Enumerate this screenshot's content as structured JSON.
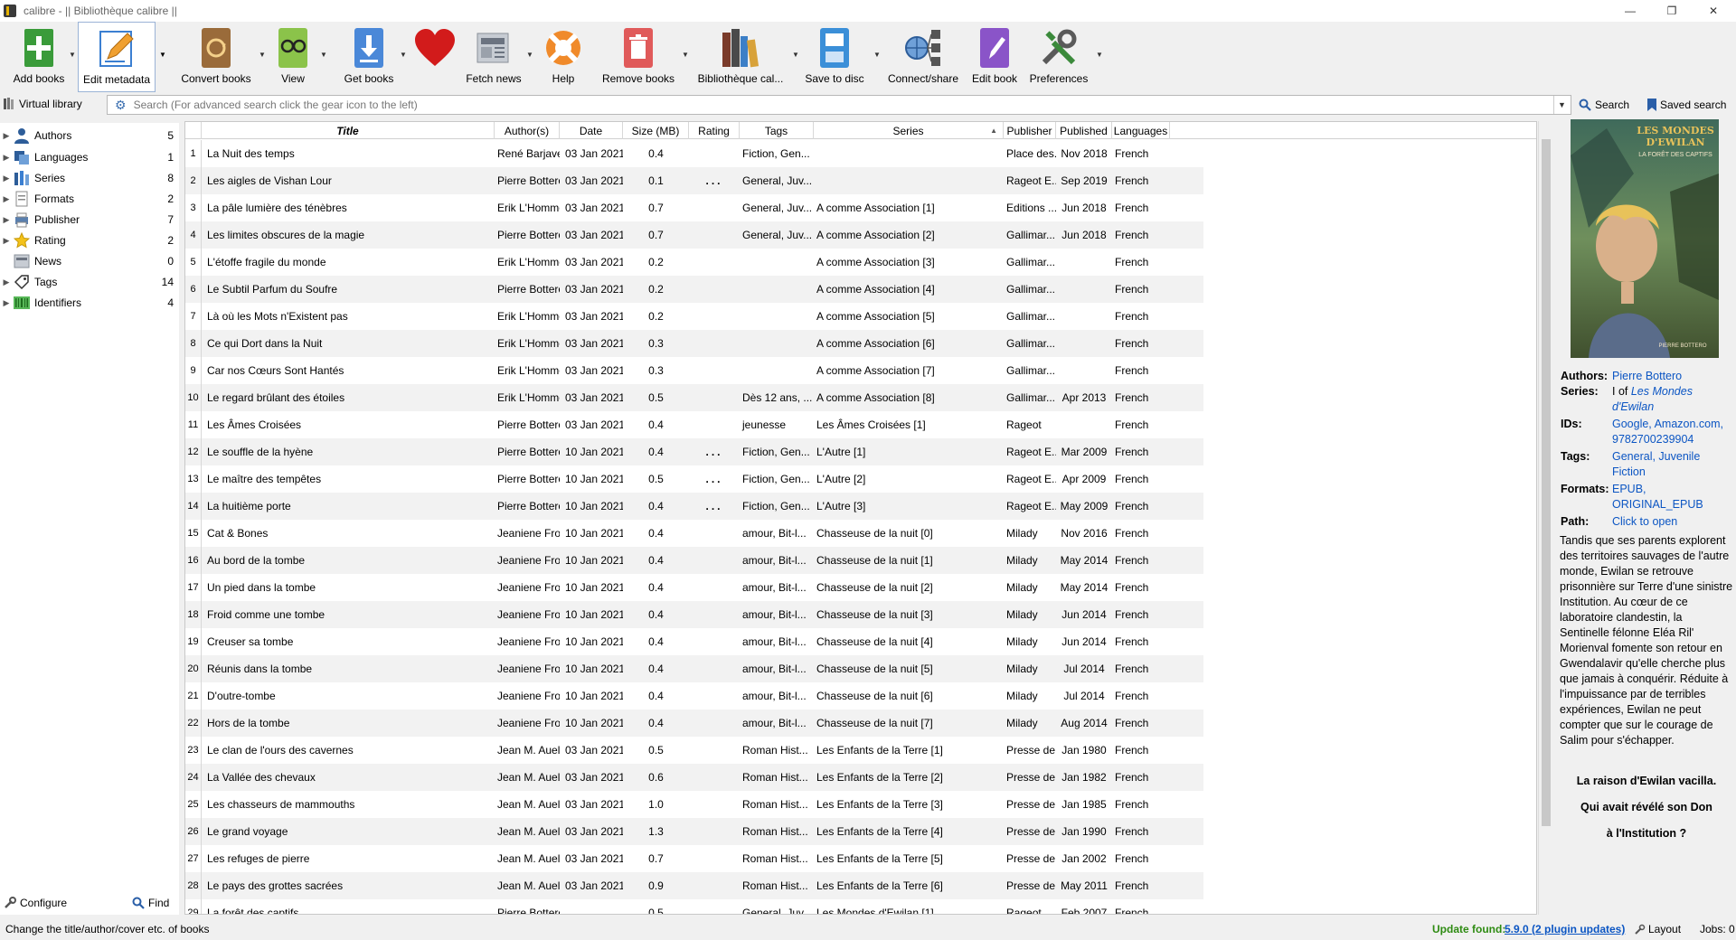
{
  "window": {
    "title": "calibre - || Bibliothèque calibre ||",
    "controls": [
      "—",
      "❐",
      "✕"
    ]
  },
  "toolbar": {
    "buttons": [
      {
        "label": "Add books",
        "icon": "add-books-icon",
        "has_menu": true
      },
      {
        "label": "Edit metadata",
        "icon": "edit-metadata-icon",
        "has_menu": true,
        "active": true
      },
      {
        "label": "Convert books",
        "icon": "convert-books-icon",
        "has_menu": true
      },
      {
        "label": "View",
        "icon": "view-icon",
        "has_menu": true
      },
      {
        "label": "Get books",
        "icon": "get-books-icon",
        "has_menu": true
      },
      {
        "label": "",
        "icon": "heart-icon",
        "has_menu": false
      },
      {
        "label": "Fetch news",
        "icon": "fetch-news-icon",
        "has_menu": true
      },
      {
        "label": "Help",
        "icon": "help-icon",
        "has_menu": false
      },
      {
        "label": "Remove books",
        "icon": "remove-books-icon",
        "has_menu": true
      },
      {
        "label": "Bibliothèque cal...",
        "icon": "library-icon",
        "has_menu": true
      },
      {
        "label": "Save to disc",
        "icon": "save-to-disc-icon",
        "has_menu": true
      },
      {
        "label": "Connect/share",
        "icon": "connect-share-icon",
        "has_menu": true
      },
      {
        "label": "Edit book",
        "icon": "edit-book-icon",
        "has_menu": false
      },
      {
        "label": "Preferences",
        "icon": "preferences-icon",
        "has_menu": true
      }
    ]
  },
  "search": {
    "virtual_library": "Virtual library",
    "placeholder": "Search (For advanced search click the gear icon to the left)",
    "search_label": "Search",
    "saved_search_label": "Saved search"
  },
  "tag_browser": {
    "items": [
      {
        "label": "Authors",
        "count": "5",
        "icon": "authors-icon"
      },
      {
        "label": "Languages",
        "count": "1",
        "icon": "languages-icon"
      },
      {
        "label": "Series",
        "count": "8",
        "icon": "series-icon"
      },
      {
        "label": "Formats",
        "count": "2",
        "icon": "formats-icon"
      },
      {
        "label": "Publisher",
        "count": "7",
        "icon": "publisher-icon"
      },
      {
        "label": "Rating",
        "count": "2",
        "icon": "rating-icon"
      },
      {
        "label": "News",
        "count": "0",
        "icon": "news-icon"
      },
      {
        "label": "Tags",
        "count": "14",
        "icon": "tags-icon"
      },
      {
        "label": "Identifiers",
        "count": "4",
        "icon": "identifiers-icon"
      }
    ],
    "configure_label": "Configure",
    "find_label": "Find"
  },
  "table": {
    "columns": [
      "Title",
      "Author(s)",
      "Date",
      "Size (MB)",
      "Rating",
      "Tags",
      "Series",
      "Publisher",
      "Published",
      "Languages"
    ],
    "rows": [
      [
        "La Nuit des temps",
        "René Barjavel",
        "03 Jan 2021",
        "0.4",
        "",
        "Fiction, Gen...",
        "",
        "Place des...",
        "Nov 2018",
        "French"
      ],
      [
        "Les aigles de Vishan Lour",
        "Pierre Bottero",
        "03 Jan 2021",
        "0.1",
        "...",
        "General, Juv...",
        "",
        "Rageot E...",
        "Sep 2019",
        "French"
      ],
      [
        "La pâle lumière des ténèbres",
        "Erik L'Homme",
        "03 Jan 2021",
        "0.7",
        "",
        "General, Juv...",
        "A comme Association [1]",
        "Editions ...",
        "Jun 2018",
        "French"
      ],
      [
        "Les limites obscures de la magie",
        "Pierre Bottero",
        "03 Jan 2021",
        "0.7",
        "",
        "General, Juv...",
        "A comme Association [2]",
        "Gallimar...",
        "Jun 2018",
        "French"
      ],
      [
        "L'étoffe fragile du monde",
        "Erik L'Homme",
        "03 Jan 2021",
        "0.2",
        "",
        "",
        "A comme Association [3]",
        "Gallimar...",
        "",
        "French"
      ],
      [
        "Le Subtil Parfum du Soufre",
        "Pierre Bottero",
        "03 Jan 2021",
        "0.2",
        "",
        "",
        "A comme Association [4]",
        "Gallimar...",
        "",
        "French"
      ],
      [
        "Là où les Mots n'Existent pas",
        "Erik L'Homme",
        "03 Jan 2021",
        "0.2",
        "",
        "",
        "A comme Association [5]",
        "Gallimar...",
        "",
        "French"
      ],
      [
        "Ce qui Dort dans la Nuit",
        "Erik L'Homme",
        "03 Jan 2021",
        "0.3",
        "",
        "",
        "A comme Association [6]",
        "Gallimar...",
        "",
        "French"
      ],
      [
        "Car nos Cœurs Sont Hantés",
        "Erik L'Homme",
        "03 Jan 2021",
        "0.3",
        "",
        "",
        "A comme Association [7]",
        "Gallimar...",
        "",
        "French"
      ],
      [
        "Le regard brûlant des étoiles",
        "Erik L'Homme",
        "03 Jan 2021",
        "0.5",
        "",
        "Dès 12 ans, ...",
        "A comme Association [8]",
        "Gallimar...",
        "Apr 2013",
        "French"
      ],
      [
        "Les Âmes Croisées",
        "Pierre Bottero",
        "03 Jan 2021",
        "0.4",
        "",
        "jeunesse",
        "Les Âmes Croisées [1]",
        "Rageot",
        "",
        "French"
      ],
      [
        "Le souffle de la hyène",
        "Pierre Bottero",
        "10 Jan 2021",
        "0.4",
        "...",
        "Fiction, Gen...",
        "L'Autre [1]",
        "Rageot E...",
        "Mar 2009",
        "French"
      ],
      [
        "Le maître des tempêtes",
        "Pierre Bottero",
        "10 Jan 2021",
        "0.5",
        "...",
        "Fiction, Gen...",
        "L'Autre [2]",
        "Rageot E...",
        "Apr 2009",
        "French"
      ],
      [
        "La huitième porte",
        "Pierre Bottero",
        "10 Jan 2021",
        "0.4",
        "...",
        "Fiction, Gen...",
        "L'Autre [3]",
        "Rageot E...",
        "May 2009",
        "French"
      ],
      [
        "Cat & Bones",
        "Jeaniene Frost",
        "10 Jan 2021",
        "0.4",
        "",
        "amour, Bit-l...",
        "Chasseuse de la nuit [0]",
        "Milady",
        "Nov 2016",
        "French"
      ],
      [
        "Au bord de la tombe",
        "Jeaniene Frost",
        "10 Jan 2021",
        "0.4",
        "",
        "amour, Bit-l...",
        "Chasseuse de la nuit [1]",
        "Milady",
        "May 2014",
        "French"
      ],
      [
        "Un pied dans la tombe",
        "Jeaniene Frost",
        "10 Jan 2021",
        "0.4",
        "",
        "amour, Bit-l...",
        "Chasseuse de la nuit [2]",
        "Milady",
        "May 2014",
        "French"
      ],
      [
        "Froid comme une tombe",
        "Jeaniene Frost",
        "10 Jan 2021",
        "0.4",
        "",
        "amour, Bit-l...",
        "Chasseuse de la nuit [3]",
        "Milady",
        "Jun 2014",
        "French"
      ],
      [
        "Creuser sa tombe",
        "Jeaniene Frost",
        "10 Jan 2021",
        "0.4",
        "",
        "amour, Bit-l...",
        "Chasseuse de la nuit [4]",
        "Milady",
        "Jun 2014",
        "French"
      ],
      [
        "Réunis dans la tombe",
        "Jeaniene Frost",
        "10 Jan 2021",
        "0.4",
        "",
        "amour, Bit-l...",
        "Chasseuse de la nuit [5]",
        "Milady",
        "Jul 2014",
        "French"
      ],
      [
        "D'outre-tombe",
        "Jeaniene Frost",
        "10 Jan 2021",
        "0.4",
        "",
        "amour, Bit-l...",
        "Chasseuse de la nuit [6]",
        "Milady",
        "Jul 2014",
        "French"
      ],
      [
        "Hors de la tombe",
        "Jeaniene Frost",
        "10 Jan 2021",
        "0.4",
        "",
        "amour, Bit-l...",
        "Chasseuse de la nuit [7]",
        "Milady",
        "Aug 2014",
        "French"
      ],
      [
        "Le clan de l'ours des cavernes",
        "Jean M. Auel",
        "03 Jan 2021",
        "0.5",
        "",
        "Roman Hist...",
        "Les Enfants de la Terre [1]",
        "Presse de...",
        "Jan 1980",
        "French"
      ],
      [
        "La Vallée des chevaux",
        "Jean M. Auel",
        "03 Jan 2021",
        "0.6",
        "",
        "Roman Hist...",
        "Les Enfants de la Terre [2]",
        "Presse de...",
        "Jan 1982",
        "French"
      ],
      [
        "Les chasseurs de mammouths",
        "Jean M. Auel",
        "03 Jan 2021",
        "1.0",
        "",
        "Roman Hist...",
        "Les Enfants de la Terre [3]",
        "Presse de...",
        "Jan 1985",
        "French"
      ],
      [
        "Le grand voyage",
        "Jean M. Auel",
        "03 Jan 2021",
        "1.3",
        "",
        "Roman Hist...",
        "Les Enfants de la Terre [4]",
        "Presse de...",
        "Jan 1990",
        "French"
      ],
      [
        "Les refuges de pierre",
        "Jean M. Auel",
        "03 Jan 2021",
        "0.7",
        "",
        "Roman Hist...",
        "Les Enfants de la Terre [5]",
        "Presse de...",
        "Jan 2002",
        "French"
      ],
      [
        "Le pays des grottes sacrées",
        "Jean M. Auel",
        "03 Jan 2021",
        "0.9",
        "",
        "Roman Hist...",
        "Les Enfants de la Terre [6]",
        "Presse de...",
        "May 2011",
        "French"
      ],
      [
        "La forêt des captifs",
        "Pierre Bottero",
        "",
        "0.5",
        "...",
        "General, Juv...",
        "Les Mondes d'Ewilan [1]",
        "Rageot",
        "Feb 2007",
        "French"
      ]
    ]
  },
  "details": {
    "cover_title": "LES MONDES D'EWILAN",
    "cover_subtitle": "LA FORÊT DES CAPTIFS",
    "cover_author": "PIERRE BOTTERO",
    "authors_key": "Authors:",
    "authors_val": "Pierre Bottero",
    "series_key": "Series:",
    "series_prefix": "I of",
    "series_val": "Les Mondes d'Ewilan",
    "ids_key": "IDs:",
    "ids_val": "Google, Amazon.com, 9782700239904",
    "tags_key": "Tags:",
    "tags_val": "General, Juvenile Fiction",
    "formats_key": "Formats:",
    "formats_val": "EPUB, ORIGINAL_EPUB",
    "path_key": "Path:",
    "path_val": "Click to open",
    "description": "Tandis que ses parents explorent des territoires sauvages de l'autre monde, Ewilan se retrouve prisonnière sur Terre d'une sinistre Institution. Au cœur de ce laboratoire clandestin, la Sentinelle félonne Eléa Ril' Morienval fomente son retour en Gwendalavir qu'elle cherche plus que jamais à conquérir. Réduite à l'impuissance par de terribles expériences, Ewilan ne peut compter que sur le courage de Salim pour s'échapper.",
    "tagline1": "La raison d'Ewilan vacilla.",
    "tagline2": "Qui avait révélé son Don",
    "tagline3": "à l'Institution ?"
  },
  "statusbar": {
    "message": "Change the title/author/cover etc. of books",
    "update_label": "Update found:",
    "update_link": "5.9.0 (2 plugin updates)",
    "layout_label": "Layout",
    "jobs_label": "Jobs: 0"
  },
  "colors": {
    "link": "#0b55c3",
    "update_green": "#2e8b12",
    "row_alt": "#f2f2f2"
  }
}
